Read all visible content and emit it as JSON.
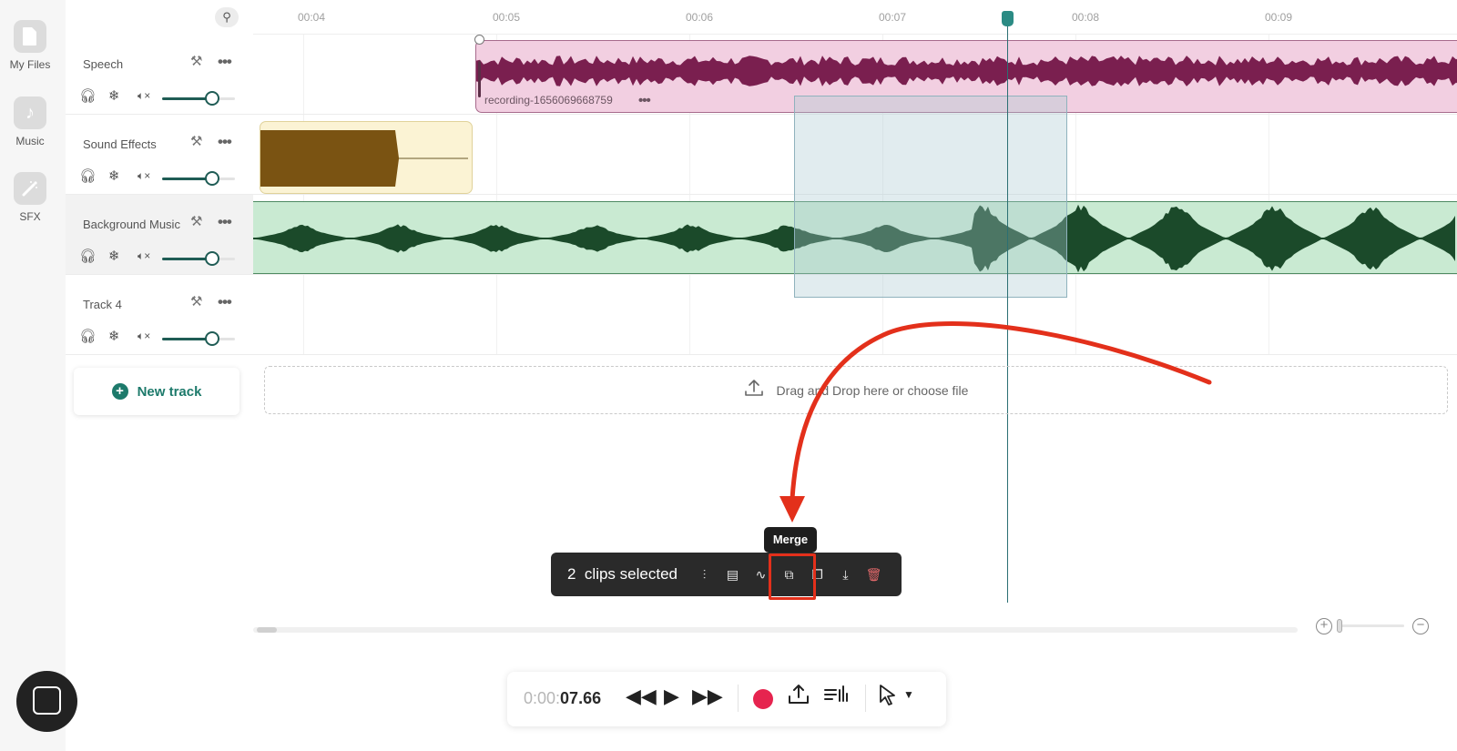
{
  "sidebar": {
    "items": [
      {
        "label": "My Files",
        "icon": "file-icon"
      },
      {
        "label": "Music",
        "icon": "music-note-icon"
      },
      {
        "label": "SFX",
        "icon": "magic-wand-icon"
      }
    ]
  },
  "ruler": {
    "ticks": [
      "00:04",
      "00:05",
      "00:06",
      "00:07",
      "00:08",
      "00:09"
    ]
  },
  "tracks": [
    {
      "name": "Speech"
    },
    {
      "name": "Sound Effects"
    },
    {
      "name": "Background Music"
    },
    {
      "name": "Track 4"
    }
  ],
  "clips": {
    "speech_clip_name": "recording-1656069668759",
    "speech_clip_menu": "•••"
  },
  "new_track_label": "New track",
  "dropzone_label": "Drag and Drop here or choose file",
  "selection_toolbar": {
    "count": "2",
    "label": "clips selected",
    "tooltip": "Merge"
  },
  "transport": {
    "time_dim": "0:00:",
    "time_main": "07.66"
  },
  "colors": {
    "accent": "#1d7a6b",
    "speech_clip": "#f2cfe1",
    "speech_wave": "#7a1f4f",
    "sfx_clip": "#fbf3d4",
    "sfx_wave": "#7a5312",
    "music_clip": "#c9ead2",
    "music_wave": "#1b4a2a",
    "record": "#e6244f",
    "annotation": "#e3301b"
  }
}
